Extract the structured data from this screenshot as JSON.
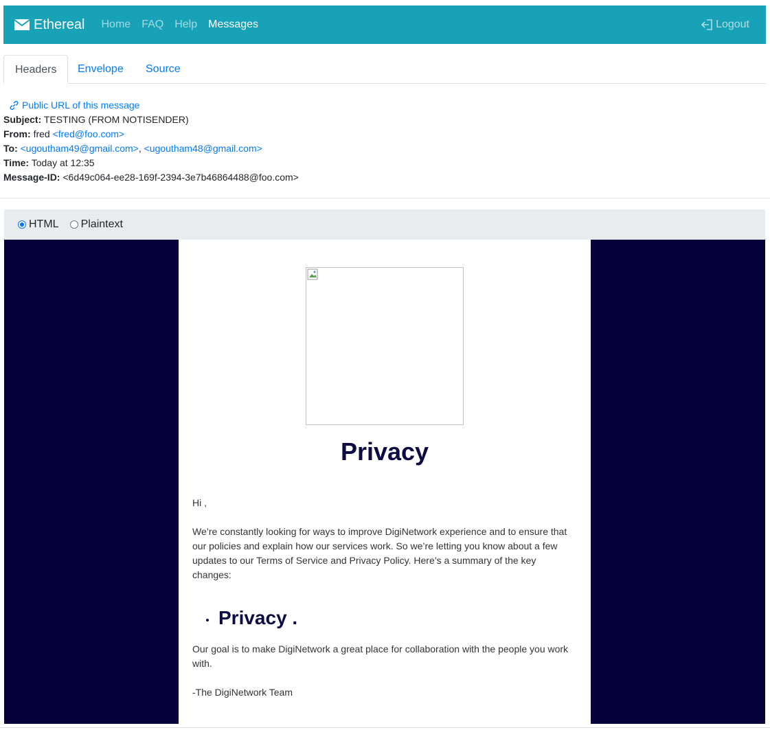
{
  "nav": {
    "brand": "Ethereal",
    "links": [
      "Home",
      "FAQ",
      "Help",
      "Messages"
    ],
    "active": "Messages",
    "logout": "Logout"
  },
  "tabs": [
    "Headers",
    "Envelope",
    "Source"
  ],
  "active_tab": "Headers",
  "headers": {
    "public_url": "Public URL of this message",
    "subject_label": "Subject:",
    "subject": "TESTING (FROM NOTISENDER)",
    "from_label": "From:",
    "from_name": "fred",
    "from_email": "<fred@foo.com>",
    "to_label": "To:",
    "to_1": "<ugoutham49@gmail.com>",
    "to_sep": ",",
    "to_2": "<ugoutham48@gmail.com>",
    "time_label": "Time:",
    "time": "Today at 12:35",
    "msgid_label": "Message-ID:",
    "msgid": "<6d49c064-ee28-169f-2394-3e7b46864488@foo.com>"
  },
  "view": {
    "html": "HTML",
    "plaintext": "Plaintext",
    "selected": "HTML"
  },
  "email": {
    "title": "Privacy",
    "greeting": "Hi ,",
    "body1": "We’re constantly looking for ways to improve DigiNetwork experience and to ensure that our policies and explain how our services work. So we’re letting you know about a few updates to our Terms of Service and Privacy Policy. Here’s a summary of the key changes:",
    "bullet": "Privacy .",
    "body2": "Our goal is to make DigiNetwork a great place for collaboration with the people you work with.",
    "signoff": "-The DigiNetwork Team",
    "bg_color": "#050138",
    "title_color": "#0e0b44"
  },
  "colors": {
    "navbar": "#17a2b8",
    "link": "#007bff"
  }
}
